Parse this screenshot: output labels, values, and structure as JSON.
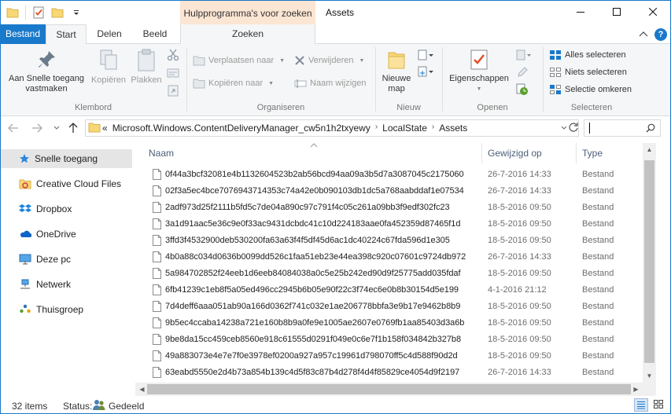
{
  "window": {
    "title": "Assets",
    "context_header": "Hulpprogramma's voor zoeken"
  },
  "tabs": {
    "file": "Bestand",
    "start": "Start",
    "share": "Delen",
    "view": "Beeld",
    "search": "Zoeken"
  },
  "ribbon": {
    "clipboard": {
      "label": "Klembord",
      "pin": "Aan Snelle toegang vastmaken",
      "copy": "Kopiëren",
      "paste": "Plakken"
    },
    "organize": {
      "label": "Organiseren",
      "move_to": "Verplaatsen naar",
      "copy_to": "Kopiëren naar",
      "delete": "Verwijderen",
      "rename": "Naam wijzigen"
    },
    "new": {
      "label": "Nieuw",
      "new_folder": "Nieuwe map"
    },
    "open": {
      "label": "Openen",
      "properties": "Eigenschappen"
    },
    "select": {
      "label": "Selecteren",
      "select_all": "Alles selecteren",
      "select_none": "Niets selecteren",
      "invert": "Selectie omkeren"
    }
  },
  "address": {
    "overflow": "«",
    "crumbs": [
      "Microsoft.Windows.ContentDeliveryManager_cw5n1h2txyewy",
      "LocalState",
      "Assets"
    ]
  },
  "nav": {
    "items": [
      "Snelle toegang",
      "Creative Cloud Files",
      "Dropbox",
      "OneDrive",
      "Deze pc",
      "Netwerk",
      "Thuisgroep"
    ]
  },
  "columns": {
    "name": "Naam",
    "modified": "Gewijzigd op",
    "type": "Type"
  },
  "files": [
    {
      "name": "0f44a3bcf32081e4b1132604523b2ab56bcd94aa09a3b5d7a3087045c2175060",
      "date": "26-7-2016 14:33",
      "type": "Bestand"
    },
    {
      "name": "02f3a5ec4bce7076943714353c74a42e0b090103db1dc5a768aabddaf1e07534",
      "date": "26-7-2016 14:33",
      "type": "Bestand"
    },
    {
      "name": "2adf973d25f2111b5fd5c7de04a890c97c791f4c05c261a09bb3f9edf302fc23",
      "date": "18-5-2016 09:50",
      "type": "Bestand"
    },
    {
      "name": "3a1d91aac5e36c9e0f33ac9431dcbdc41c10d224183aae0fa452359d87465f1d",
      "date": "18-5-2016 09:50",
      "type": "Bestand"
    },
    {
      "name": "3ffd3f4532900deb530200fa63a63f4f5df45d6ac1dc40224c67fda596d1e305",
      "date": "18-5-2016 09:50",
      "type": "Bestand"
    },
    {
      "name": "4b0a88c034d0636b0099dd526c1faa51eb23e44ea398c920c07601c9724db972",
      "date": "26-7-2016 14:33",
      "type": "Bestand"
    },
    {
      "name": "5a984702852f24eeb1d6eeb84084038a0c5e25b242ed90d9f25775add035fdaf",
      "date": "18-5-2016 09:50",
      "type": "Bestand"
    },
    {
      "name": "6fb41239c1eb8f5a05ed496cc2945b6b05e90f22c3f74ec6e0b8b30154d5e199",
      "date": "4-1-2016 21:12",
      "type": "Bestand"
    },
    {
      "name": "7d4deff6aaa051ab90a166d0362f741c032e1ae206778bbfa3e9b17e9462b8b9",
      "date": "18-5-2016 09:50",
      "type": "Bestand"
    },
    {
      "name": "9b5ec4ccaba14238a721e160b8b9a0fe9e1005ae2607e0769fb1aa85403d3a6b",
      "date": "18-5-2016 09:50",
      "type": "Bestand"
    },
    {
      "name": "9be8da15cc459ceb8560e918c61555d0291f049e0c6e7f1b158f034842b327b8",
      "date": "18-5-2016 09:50",
      "type": "Bestand"
    },
    {
      "name": "49a883073e4e7e7f0e3978ef0200a927a957c19961d798070ff5c4d588f90d2d",
      "date": "18-5-2016 09:50",
      "type": "Bestand"
    },
    {
      "name": "63eabd5550e2d4b73a854b139c4d5f83c87b4d278f4d4f85829ce4054d9f2197",
      "date": "26-7-2016 14:33",
      "type": "Bestand"
    }
  ],
  "status": {
    "count": "32 items",
    "label": "Status:",
    "value": "Gedeeld"
  },
  "colors": {
    "accent": "#1979ca",
    "context_tab": "#fbe5d3",
    "ribbon_bg": "#f5f6f7"
  }
}
